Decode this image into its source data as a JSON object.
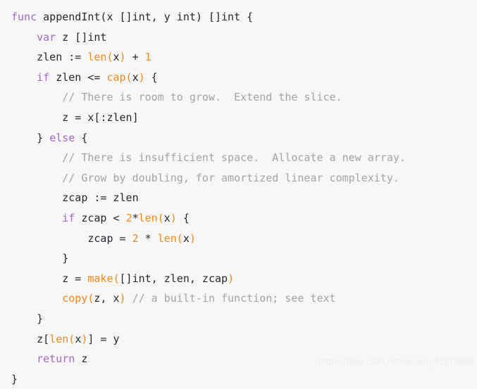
{
  "editor": {
    "language": "go",
    "background_color": "#f7f7f7",
    "colors": {
      "keyword": "#a26ac4",
      "builtin_function": "#f5871f",
      "number": "#f5871f",
      "comment": "#a0a4a8",
      "plain": "#24292e",
      "watermark": "#ededed"
    },
    "indent_unit": "    ",
    "full_code": "func appendInt(x []int, y int) []int {\n    var z []int\n    zlen := len(x) + 1\n    if zlen <= cap(x) {\n        // There is room to grow.  Extend the slice.\n        z = x[:zlen]\n    } else {\n        // There is insufficient space.  Allocate a new array.\n        // Grow by doubling, for amortized linear complexity.\n        zcap := zlen\n        if zcap < 2*len(x) {\n            zcap = 2 * len(x)\n        }\n        z = make([]int, zlen, zcap)\n        copy(z, x) // a built-in function; see text\n    }\n    z[len(x)] = y\n    return z\n}",
    "lines": [
      {
        "n": 1,
        "text": "func appendInt(x []int, y int) []int {",
        "tokens": [
          {
            "t": "func",
            "c": "kw"
          },
          {
            "t": " appendInt(x []int, y int) []int {",
            "c": "plain"
          }
        ]
      },
      {
        "n": 2,
        "text": "    var z []int",
        "tokens": [
          {
            "t": "    ",
            "c": "plain"
          },
          {
            "t": "var",
            "c": "kw"
          },
          {
            "t": " z []int",
            "c": "plain"
          }
        ]
      },
      {
        "n": 3,
        "text": "    zlen := len(x) + 1",
        "tokens": [
          {
            "t": "    zlen := ",
            "c": "plain"
          },
          {
            "t": "len(",
            "c": "fn"
          },
          {
            "t": "x",
            "c": "plain"
          },
          {
            "t": ")",
            "c": "fn"
          },
          {
            "t": " + ",
            "c": "plain"
          },
          {
            "t": "1",
            "c": "num"
          }
        ]
      },
      {
        "n": 4,
        "text": "    if zlen <= cap(x) {",
        "tokens": [
          {
            "t": "    ",
            "c": "plain"
          },
          {
            "t": "if",
            "c": "kw"
          },
          {
            "t": " zlen <= ",
            "c": "plain"
          },
          {
            "t": "cap(",
            "c": "fn"
          },
          {
            "t": "x",
            "c": "plain"
          },
          {
            "t": ")",
            "c": "fn"
          },
          {
            "t": " {",
            "c": "plain"
          }
        ]
      },
      {
        "n": 5,
        "text": "        // There is room to grow.  Extend the slice.",
        "tokens": [
          {
            "t": "        ",
            "c": "plain"
          },
          {
            "t": "// There is room to grow.  Extend the slice.",
            "c": "com"
          }
        ]
      },
      {
        "n": 6,
        "text": "        z = x[:zlen]",
        "tokens": [
          {
            "t": "        z = x[:zlen]",
            "c": "plain"
          }
        ]
      },
      {
        "n": 7,
        "text": "    } else {",
        "tokens": [
          {
            "t": "    } ",
            "c": "plain"
          },
          {
            "t": "else",
            "c": "kw"
          },
          {
            "t": " {",
            "c": "plain"
          }
        ]
      },
      {
        "n": 8,
        "text": "        // There is insufficient space.  Allocate a new array.",
        "tokens": [
          {
            "t": "        ",
            "c": "plain"
          },
          {
            "t": "// There is insufficient space.  Allocate a new array.",
            "c": "com"
          }
        ]
      },
      {
        "n": 9,
        "text": "        // Grow by doubling, for amortized linear complexity.",
        "tokens": [
          {
            "t": "        ",
            "c": "plain"
          },
          {
            "t": "// Grow by doubling, for amortized linear complexity.",
            "c": "com"
          }
        ]
      },
      {
        "n": 10,
        "text": "        zcap := zlen",
        "tokens": [
          {
            "t": "        zcap := zlen",
            "c": "plain"
          }
        ]
      },
      {
        "n": 11,
        "text": "        if zcap < 2*len(x) {",
        "tokens": [
          {
            "t": "        ",
            "c": "plain"
          },
          {
            "t": "if",
            "c": "kw"
          },
          {
            "t": " zcap < ",
            "c": "plain"
          },
          {
            "t": "2",
            "c": "num"
          },
          {
            "t": "*",
            "c": "plain"
          },
          {
            "t": "len(",
            "c": "fn"
          },
          {
            "t": "x",
            "c": "plain"
          },
          {
            "t": ")",
            "c": "fn"
          },
          {
            "t": " {",
            "c": "plain"
          }
        ]
      },
      {
        "n": 12,
        "text": "            zcap = 2 * len(x)",
        "tokens": [
          {
            "t": "            zcap = ",
            "c": "plain"
          },
          {
            "t": "2",
            "c": "num"
          },
          {
            "t": " * ",
            "c": "plain"
          },
          {
            "t": "len(",
            "c": "fn"
          },
          {
            "t": "x",
            "c": "plain"
          },
          {
            "t": ")",
            "c": "fn"
          }
        ]
      },
      {
        "n": 13,
        "text": "        }",
        "tokens": [
          {
            "t": "        }",
            "c": "plain"
          }
        ]
      },
      {
        "n": 14,
        "text": "        z = make([]int, zlen, zcap)",
        "tokens": [
          {
            "t": "        z = ",
            "c": "plain"
          },
          {
            "t": "make(",
            "c": "fn"
          },
          {
            "t": "[]int, zlen, zcap",
            "c": "plain"
          },
          {
            "t": ")",
            "c": "fn"
          }
        ]
      },
      {
        "n": 15,
        "text": "        copy(z, x) // a built-in function; see text",
        "tokens": [
          {
            "t": "        ",
            "c": "plain"
          },
          {
            "t": "copy(",
            "c": "fn"
          },
          {
            "t": "z, x",
            "c": "plain"
          },
          {
            "t": ")",
            "c": "fn"
          },
          {
            "t": " ",
            "c": "plain"
          },
          {
            "t": "// a built-in function; see text",
            "c": "com"
          }
        ]
      },
      {
        "n": 16,
        "text": "    }",
        "tokens": [
          {
            "t": "    }",
            "c": "plain"
          }
        ]
      },
      {
        "n": 17,
        "text": "    z[len(x)] = y",
        "tokens": [
          {
            "t": "    z[",
            "c": "plain"
          },
          {
            "t": "len(",
            "c": "fn"
          },
          {
            "t": "x",
            "c": "plain"
          },
          {
            "t": ")",
            "c": "fn"
          },
          {
            "t": "] = y",
            "c": "plain"
          }
        ]
      },
      {
        "n": 18,
        "text": "    return z",
        "tokens": [
          {
            "t": "    ",
            "c": "plain"
          },
          {
            "t": "return",
            "c": "kw"
          },
          {
            "t": " z",
            "c": "plain"
          }
        ]
      },
      {
        "n": 19,
        "text": "}",
        "tokens": [
          {
            "t": "}",
            "c": "plain"
          }
        ]
      }
    ]
  },
  "watermark": {
    "text": "https://blog.csdn.net/weixin_41910694"
  }
}
